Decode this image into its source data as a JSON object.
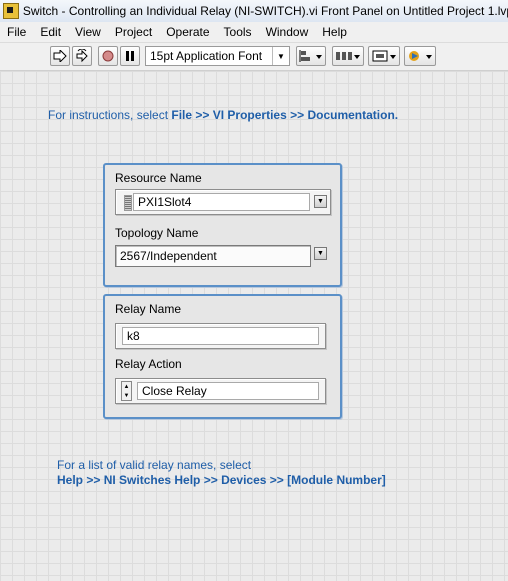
{
  "window": {
    "title": "Switch - Controlling an Individual Relay (NI-SWITCH).vi Front Panel on Untitled Project 1.lvp"
  },
  "menu": [
    "File",
    "Edit",
    "View",
    "Project",
    "Operate",
    "Tools",
    "Window",
    "Help"
  ],
  "toolbar": {
    "font_label": "15pt Application Font",
    "icons": [
      "run-arrow-icon",
      "run-continuously-icon",
      "abort-icon",
      "pause-icon",
      "align-objects-icon",
      "distribute-objects-icon",
      "resize-objects-icon",
      "reorder-icon"
    ]
  },
  "instructions": {
    "prefix": "For instructions, select ",
    "path": "File >> VI Properties >> Documentation."
  },
  "cluster1": {
    "resource_label": "Resource Name",
    "resource_value": "PXI1Slot4",
    "topology_label": "Topology Name",
    "topology_value": "2567/Independent"
  },
  "cluster2": {
    "relay_label": "Relay Name",
    "relay_value": "k8",
    "action_label": "Relay Action",
    "action_value": "Close Relay"
  },
  "footer": {
    "line1": "For a list of valid relay names, select",
    "line2": "Help >> NI Switches Help >> Devices >> [Module Number]"
  }
}
